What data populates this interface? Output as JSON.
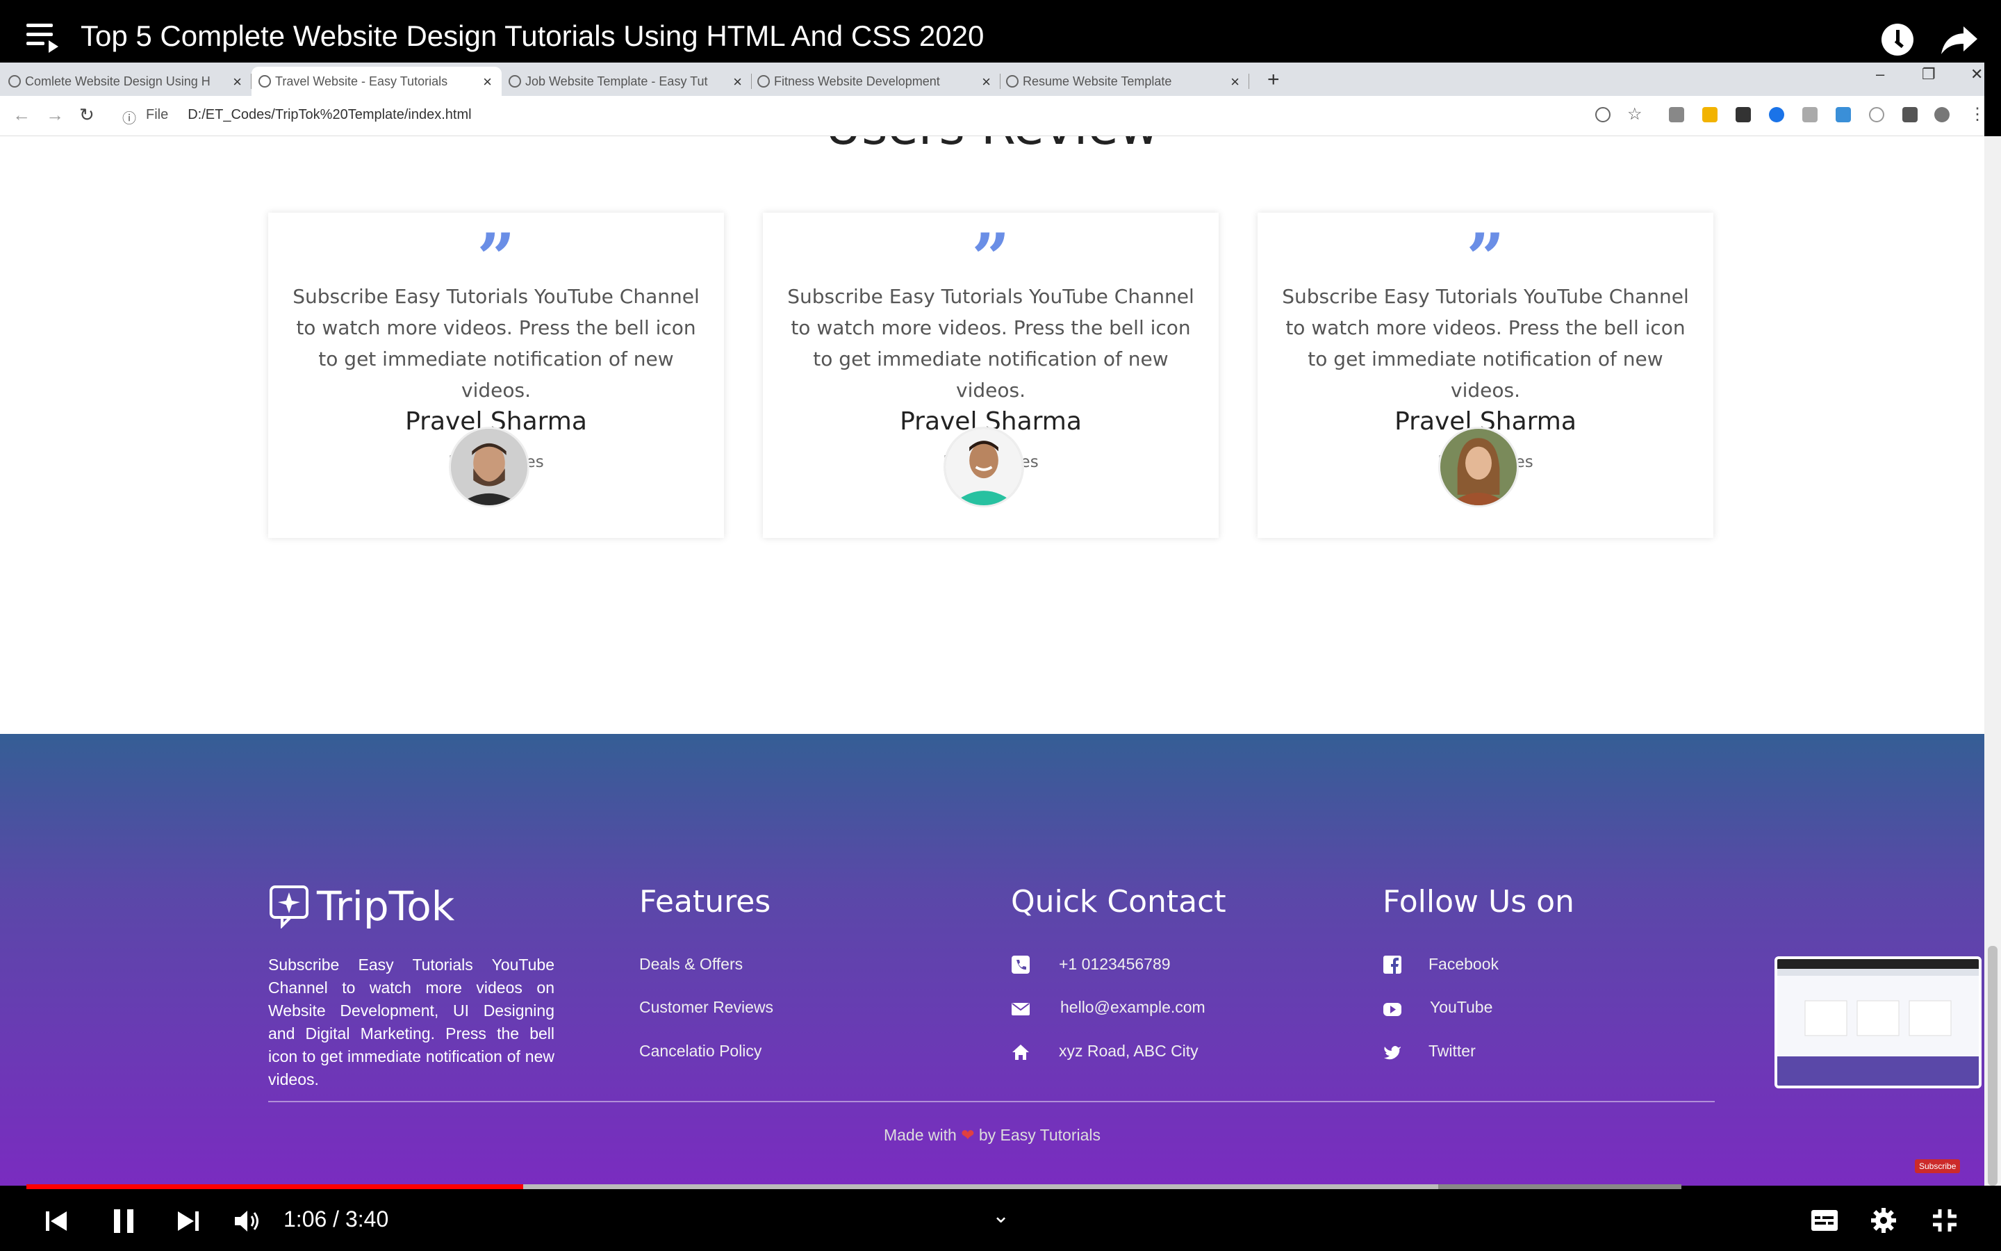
{
  "video": {
    "title": "Top 5 Complete Website Design Tutorials Using HTML And CSS 2020",
    "time_current": "1:06",
    "time_total": "3:40",
    "time_display": "1:06 / 3:40",
    "progress_played": 0.3,
    "progress_loaded": 0.853
  },
  "browser": {
    "tabs": [
      {
        "label": "Comlete Website Design Using H",
        "active": false
      },
      {
        "label": "Travel Website - Easy Tutorials",
        "active": true
      },
      {
        "label": "Job Website Template - Easy Tut",
        "active": false
      },
      {
        "label": "Fitness Website Development",
        "active": false
      },
      {
        "label": "Resume Website Template",
        "active": false
      }
    ],
    "new_tab": "+",
    "url_scheme": "File",
    "url": "D:/ET_Codes/TripTok%20Template/index.html"
  },
  "page": {
    "section_title": "Users Review",
    "reviews": [
      {
        "text": "Subscribe Easy Tutorials YouTube Channel to watch more videos. Press the bell icon to get immediate notification of new videos.",
        "name": "Pravel Sharma",
        "city": "Los Angeles"
      },
      {
        "text": "Subscribe Easy Tutorials YouTube Channel to watch more videos. Press the bell icon to get immediate notification of new videos.",
        "name": "Pravel Sharma",
        "city": "Los Angeles"
      },
      {
        "text": "Subscribe Easy Tutorials YouTube Channel to watch more videos. Press the bell icon to get immediate notification of new videos.",
        "name": "Pravel Sharma",
        "city": "Los Angeles"
      }
    ],
    "quote_mark": "”"
  },
  "footer": {
    "logo": "TripTok",
    "about": "Subscribe Easy Tutorials YouTube Channel to watch more videos on Website Development, UI Designing and Digital Marketing. Press the bell icon to get immediate notification of new videos.",
    "features": {
      "heading": "Features",
      "links": [
        "Deals & Offers",
        "Customer Reviews",
        "Cancelatio Policy"
      ]
    },
    "contact": {
      "heading": "Quick Contact",
      "items": [
        {
          "icon": "phone-icon",
          "text": "+1 0123456789"
        },
        {
          "icon": "mail-icon",
          "text": "hello@example.com"
        },
        {
          "icon": "home-icon",
          "text": "xyz Road, ABC City"
        }
      ]
    },
    "social": {
      "heading": "Follow Us on",
      "items": [
        {
          "icon": "facebook-icon",
          "text": "Facebook"
        },
        {
          "icon": "youtube-icon",
          "text": "YouTube"
        },
        {
          "icon": "twitter-icon",
          "text": "Twitter"
        }
      ]
    },
    "made_prefix": "Made with",
    "made_suffix": "by Easy Tutorials",
    "subscribe": "Subscribe"
  },
  "colors": {
    "accent_quote": "#6a8ee6",
    "footer_top": "#355e95",
    "footer_bottom": "#7a2cc0",
    "progress_red": "#ff0000"
  }
}
